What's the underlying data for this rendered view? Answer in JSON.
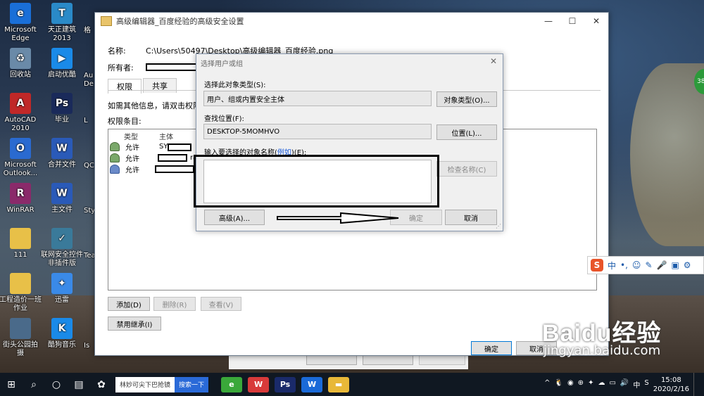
{
  "desktop": {
    "icons_left": [
      {
        "label": "Microsoft\nEdge",
        "color": "#1a6fd8",
        "glyph": "e"
      },
      {
        "label": "回收站",
        "color": "#6a8aa8",
        "glyph": "♻"
      },
      {
        "label": "AutoCAD\n2010",
        "color": "#c02828",
        "glyph": "A"
      },
      {
        "label": "Microsoft\nOutlook...",
        "color": "#2a6ad0",
        "glyph": "O"
      },
      {
        "label": "WinRAR",
        "color": "#8a2a6a",
        "glyph": "R"
      },
      {
        "label": "111",
        "color": "#e8c048",
        "glyph": ""
      },
      {
        "label": "工程造价一班\n作业",
        "color": "#e8c048",
        "glyph": ""
      },
      {
        "label": "街头公园拍\n摄",
        "color": "#4a6a8a",
        "glyph": ""
      }
    ],
    "icons_col2": [
      {
        "label": "天正建筑\n2013",
        "color": "#2a8ac8",
        "glyph": "T"
      },
      {
        "label": "启动优酷",
        "color": "#1a8ae8",
        "glyph": "▶"
      },
      {
        "label": "毕业",
        "color": "#1a2a5a",
        "glyph": "Ps"
      },
      {
        "label": "合并文件",
        "color": "#2a5ab8",
        "glyph": "W"
      },
      {
        "label": "主文件",
        "color": "#2a5ab8",
        "glyph": "W"
      },
      {
        "label": "联网安全控件\n非插件版",
        "color": "#3a7a9a",
        "glyph": "✓"
      },
      {
        "label": "迅雷",
        "color": "#3a8ae8",
        "glyph": "✦"
      },
      {
        "label": "酷狗音乐",
        "color": "#1a8ae8",
        "glyph": "K"
      }
    ],
    "icons_col3_fragments": [
      "格",
      "Au\nDe",
      "L",
      "QC",
      "Styl",
      "Tea",
      "",
      "Is"
    ]
  },
  "main_window": {
    "title": "高级编辑器_百度经验的高级安全设置",
    "name_label": "名称:",
    "name_value": "C:\\Users\\50497\\Desktop\\高级编辑器_百度经验.png",
    "owner_label": "所有者:",
    "tabs": [
      "权限",
      "共享"
    ],
    "info_text": "如需其他信息，请双击权限项",
    "entries_label": "权限条目:",
    "columns": [
      "类型",
      "主体"
    ],
    "rows": [
      {
        "type": "允许",
        "principal": "SY"
      },
      {
        "type": "允许",
        "principal": "ra"
      },
      {
        "type": "允许",
        "principal": ""
      }
    ],
    "add_button": "添加(D)",
    "remove_button": "删除(R)",
    "view_button": "查看(V)",
    "disable_inherit_button": "禁用继承(I)",
    "ok_button": "确定",
    "cancel_button": "取消"
  },
  "dialog": {
    "title": "选择用户或组",
    "object_type_label": "选择此对象类型(S):",
    "object_type_value": "用户、组或内置安全主体",
    "object_type_button": "对象类型(O)...",
    "location_label": "查找位置(F):",
    "location_value": "DESKTOP-5MOMHVO",
    "location_button": "位置(L)...",
    "enter_label": "输入要选择的对象名称(",
    "enter_link": "例如",
    "enter_label_end": ")(E):",
    "input_value": "",
    "check_names_button": "检查名称(C)",
    "advanced_button": "高级(A)...",
    "ok_button": "确定",
    "cancel_button": "取消"
  },
  "ime_bar": {
    "logo": "S",
    "mode": "中",
    "items": [
      "•,",
      "☺",
      "✎",
      "🎤",
      "▣",
      "⚙"
    ]
  },
  "watermark": {
    "brand": "Baidu",
    "brand_cn": "经验",
    "url": "jingyan.baidu.com"
  },
  "green_badge": "38",
  "taskbar": {
    "search_text": "林妙可尖下巴抢镜",
    "search_button": "搜索一下",
    "apps": [
      {
        "name": "360",
        "color": "#3aa83a",
        "glyph": "e"
      },
      {
        "name": "wps",
        "color": "#d83a3a",
        "glyph": "W"
      },
      {
        "name": "ps",
        "color": "#1a2a6a",
        "glyph": "Ps"
      },
      {
        "name": "word",
        "color": "#1a6ad8",
        "glyph": "W"
      },
      {
        "name": "explorer",
        "color": "#e8b838",
        "glyph": "▬"
      }
    ],
    "tray_items": [
      "^",
      "🐧",
      "◉",
      "⊕",
      "✦",
      "☁",
      "▭",
      "🔊",
      "中",
      "S"
    ],
    "time": "15:08",
    "date": "2020/2/16"
  }
}
